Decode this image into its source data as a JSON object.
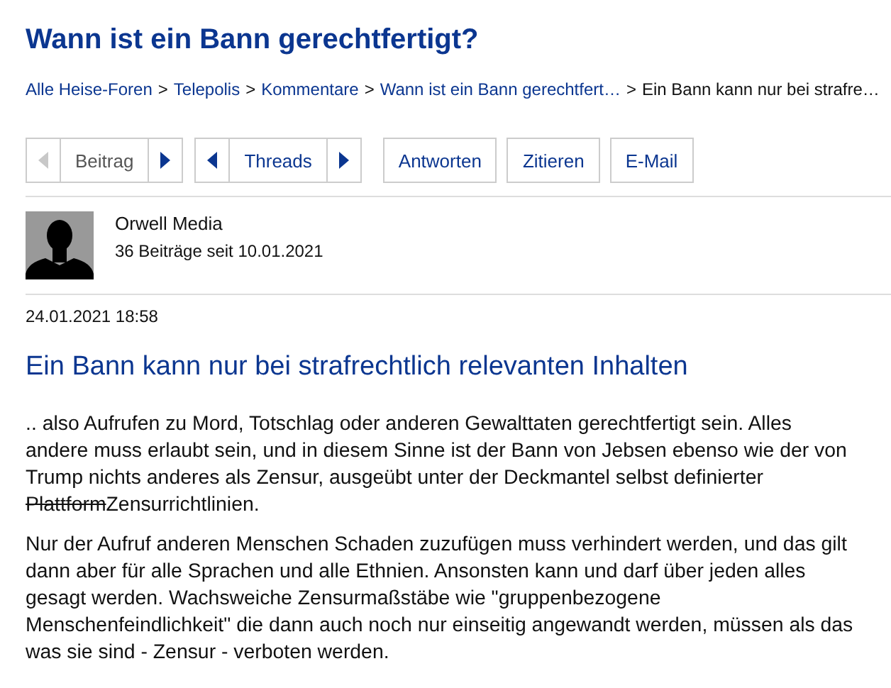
{
  "title": "Wann ist ein Bann gerechtfertigt?",
  "breadcrumbs": [
    {
      "kind": "link",
      "label": "Alle Heise-Foren"
    },
    {
      "kind": "separator",
      "label": ">"
    },
    {
      "kind": "link",
      "label": "Telepolis"
    },
    {
      "kind": "separator",
      "label": ">"
    },
    {
      "kind": "link",
      "label": "Kommentare"
    },
    {
      "kind": "separator",
      "label": ">"
    },
    {
      "kind": "link",
      "label": "Wann ist ein Bann gerechtfert…"
    },
    {
      "kind": "separator",
      "label": ">"
    },
    {
      "kind": "current",
      "label": "Ein Bann kann nur bei strafre…"
    }
  ],
  "navigation": [
    {
      "label": "Beitrag",
      "previous_disabled": true,
      "next_disabled": false
    },
    {
      "label": "Threads",
      "previous_disabled": false,
      "next_disabled": false
    }
  ],
  "actions": [
    "Antworten",
    "Zitieren",
    "E-Mail"
  ],
  "author": {
    "name": "Orwell Media",
    "stats": "36 Beiträge seit 10.01.2021"
  },
  "date": "24.01.2021 18:58",
  "heading": "Ein Bann kann nur bei strafrechtlich relevanten Inhalten",
  "paragraphs": [
    [
      {
        "text": ".. also Aufrufen zu Mord, Totschlag oder anderen Gewalttaten gerechtfertigt sein. Alles andere muss erlaubt sein, und in diesem Sinne ist der Bann von Jebsen ebenso wie der von Trump nichts anderes als Zensur, ausgeübt unter der Deckmantel selbst definierter ",
        "struck": false
      },
      {
        "text": "Plattform",
        "struck": true
      },
      {
        "text": "Zensurrichtlinien.",
        "struck": false
      }
    ],
    [
      {
        "text": "Nur der Aufruf anderen Menschen Schaden zuzufügen muss verhindert werden, und das gilt dann aber für alle Sprachen und alle Ethnien. Ansonsten kann und darf über jeden alles gesagt werden. Wachsweiche Zensurmaßstäbe wie \"gruppenbezogene Menschenfeindlichkeit\" die dann auch noch nur einseitig angewandt werden, müssen als das was sie sind - Zensur - verboten werden.",
        "struck": false
      }
    ]
  ]
}
